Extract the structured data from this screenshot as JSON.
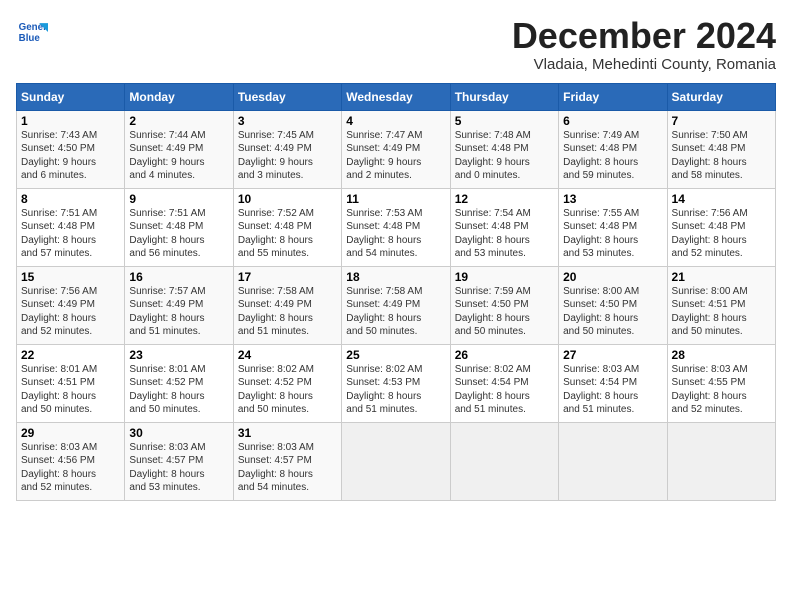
{
  "header": {
    "logo_line1": "General",
    "logo_line2": "Blue",
    "month_title": "December 2024",
    "location": "Vladaia, Mehedinti County, Romania"
  },
  "weekdays": [
    "Sunday",
    "Monday",
    "Tuesday",
    "Wednesday",
    "Thursday",
    "Friday",
    "Saturday"
  ],
  "weeks": [
    [
      {
        "day": "1",
        "info": "Sunrise: 7:43 AM\nSunset: 4:50 PM\nDaylight: 9 hours\nand 6 minutes."
      },
      {
        "day": "2",
        "info": "Sunrise: 7:44 AM\nSunset: 4:49 PM\nDaylight: 9 hours\nand 4 minutes."
      },
      {
        "day": "3",
        "info": "Sunrise: 7:45 AM\nSunset: 4:49 PM\nDaylight: 9 hours\nand 3 minutes."
      },
      {
        "day": "4",
        "info": "Sunrise: 7:47 AM\nSunset: 4:49 PM\nDaylight: 9 hours\nand 2 minutes."
      },
      {
        "day": "5",
        "info": "Sunrise: 7:48 AM\nSunset: 4:48 PM\nDaylight: 9 hours\nand 0 minutes."
      },
      {
        "day": "6",
        "info": "Sunrise: 7:49 AM\nSunset: 4:48 PM\nDaylight: 8 hours\nand 59 minutes."
      },
      {
        "day": "7",
        "info": "Sunrise: 7:50 AM\nSunset: 4:48 PM\nDaylight: 8 hours\nand 58 minutes."
      }
    ],
    [
      {
        "day": "8",
        "info": "Sunrise: 7:51 AM\nSunset: 4:48 PM\nDaylight: 8 hours\nand 57 minutes."
      },
      {
        "day": "9",
        "info": "Sunrise: 7:51 AM\nSunset: 4:48 PM\nDaylight: 8 hours\nand 56 minutes."
      },
      {
        "day": "10",
        "info": "Sunrise: 7:52 AM\nSunset: 4:48 PM\nDaylight: 8 hours\nand 55 minutes."
      },
      {
        "day": "11",
        "info": "Sunrise: 7:53 AM\nSunset: 4:48 PM\nDaylight: 8 hours\nand 54 minutes."
      },
      {
        "day": "12",
        "info": "Sunrise: 7:54 AM\nSunset: 4:48 PM\nDaylight: 8 hours\nand 53 minutes."
      },
      {
        "day": "13",
        "info": "Sunrise: 7:55 AM\nSunset: 4:48 PM\nDaylight: 8 hours\nand 53 minutes."
      },
      {
        "day": "14",
        "info": "Sunrise: 7:56 AM\nSunset: 4:48 PM\nDaylight: 8 hours\nand 52 minutes."
      }
    ],
    [
      {
        "day": "15",
        "info": "Sunrise: 7:56 AM\nSunset: 4:49 PM\nDaylight: 8 hours\nand 52 minutes."
      },
      {
        "day": "16",
        "info": "Sunrise: 7:57 AM\nSunset: 4:49 PM\nDaylight: 8 hours\nand 51 minutes."
      },
      {
        "day": "17",
        "info": "Sunrise: 7:58 AM\nSunset: 4:49 PM\nDaylight: 8 hours\nand 51 minutes."
      },
      {
        "day": "18",
        "info": "Sunrise: 7:58 AM\nSunset: 4:49 PM\nDaylight: 8 hours\nand 50 minutes."
      },
      {
        "day": "19",
        "info": "Sunrise: 7:59 AM\nSunset: 4:50 PM\nDaylight: 8 hours\nand 50 minutes."
      },
      {
        "day": "20",
        "info": "Sunrise: 8:00 AM\nSunset: 4:50 PM\nDaylight: 8 hours\nand 50 minutes."
      },
      {
        "day": "21",
        "info": "Sunrise: 8:00 AM\nSunset: 4:51 PM\nDaylight: 8 hours\nand 50 minutes."
      }
    ],
    [
      {
        "day": "22",
        "info": "Sunrise: 8:01 AM\nSunset: 4:51 PM\nDaylight: 8 hours\nand 50 minutes."
      },
      {
        "day": "23",
        "info": "Sunrise: 8:01 AM\nSunset: 4:52 PM\nDaylight: 8 hours\nand 50 minutes."
      },
      {
        "day": "24",
        "info": "Sunrise: 8:02 AM\nSunset: 4:52 PM\nDaylight: 8 hours\nand 50 minutes."
      },
      {
        "day": "25",
        "info": "Sunrise: 8:02 AM\nSunset: 4:53 PM\nDaylight: 8 hours\nand 51 minutes."
      },
      {
        "day": "26",
        "info": "Sunrise: 8:02 AM\nSunset: 4:54 PM\nDaylight: 8 hours\nand 51 minutes."
      },
      {
        "day": "27",
        "info": "Sunrise: 8:03 AM\nSunset: 4:54 PM\nDaylight: 8 hours\nand 51 minutes."
      },
      {
        "day": "28",
        "info": "Sunrise: 8:03 AM\nSunset: 4:55 PM\nDaylight: 8 hours\nand 52 minutes."
      }
    ],
    [
      {
        "day": "29",
        "info": "Sunrise: 8:03 AM\nSunset: 4:56 PM\nDaylight: 8 hours\nand 52 minutes."
      },
      {
        "day": "30",
        "info": "Sunrise: 8:03 AM\nSunset: 4:57 PM\nDaylight: 8 hours\nand 53 minutes."
      },
      {
        "day": "31",
        "info": "Sunrise: 8:03 AM\nSunset: 4:57 PM\nDaylight: 8 hours\nand 54 minutes."
      },
      null,
      null,
      null,
      null
    ]
  ]
}
